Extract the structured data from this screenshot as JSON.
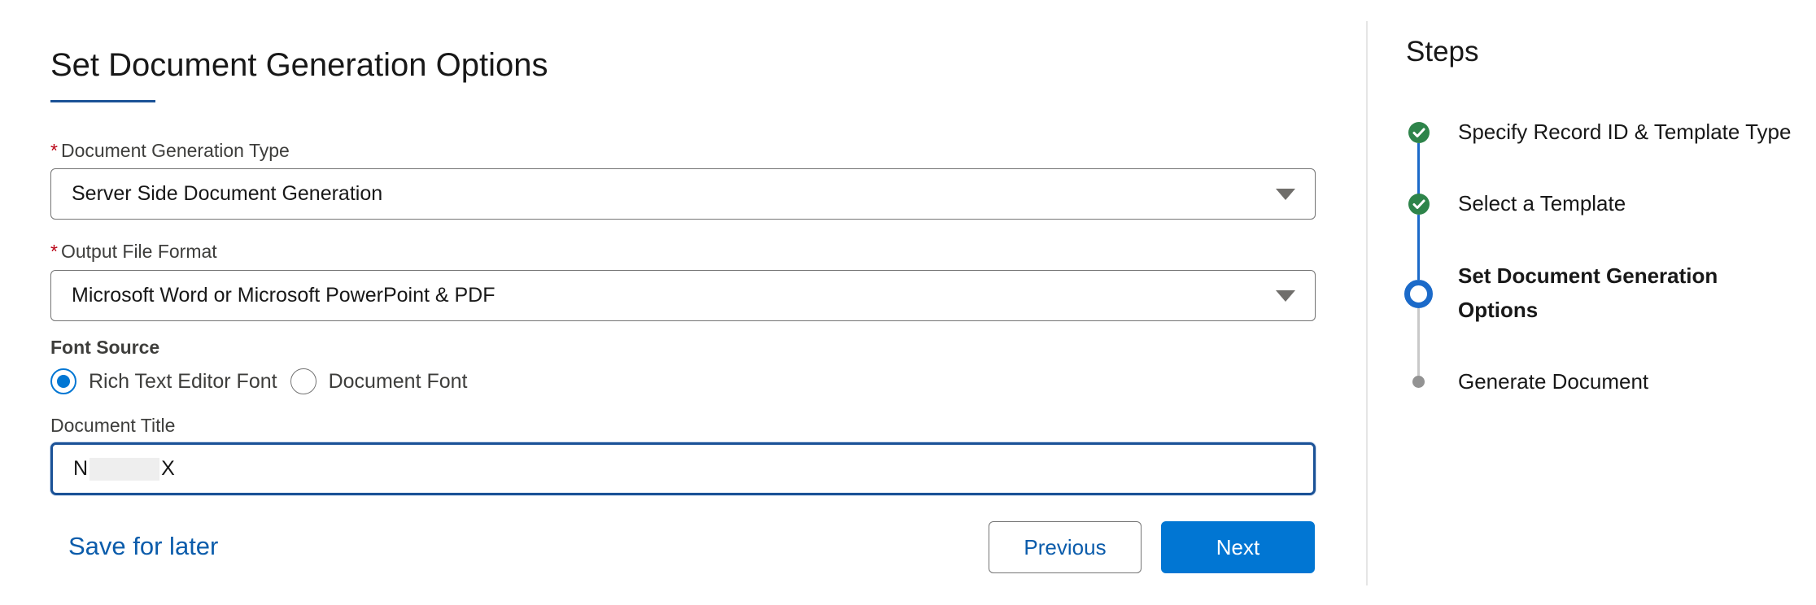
{
  "form": {
    "title": "Set Document Generation Options",
    "generation_type": {
      "label": "Document Generation Type",
      "required_marker": "*",
      "value": "Server Side Document Generation"
    },
    "output_format": {
      "label": "Output File Format",
      "required_marker": "*",
      "value": "Microsoft Word or Microsoft PowerPoint & PDF"
    },
    "font_source": {
      "label": "Font Source",
      "options": [
        {
          "label": "Rich Text Editor Font",
          "selected": true
        },
        {
          "label": "Document Font",
          "selected": false
        }
      ]
    },
    "document_title": {
      "label": "Document Title",
      "value_start": "N",
      "value_end": "X"
    },
    "save_for_later": "Save for later",
    "previous_label": "Previous",
    "next_label": "Next"
  },
  "steps": {
    "title": "Steps",
    "items": [
      {
        "label": "Specify Record ID & Template Type",
        "status": "complete"
      },
      {
        "label": "Select a Template",
        "status": "complete"
      },
      {
        "label": "Set Document Generation Options",
        "status": "current"
      },
      {
        "label": "Generate Document",
        "status": "upcoming"
      }
    ]
  },
  "colors": {
    "brand_blue": "#0176d3",
    "focus_border": "#1b5297",
    "complete_green": "#2e844a",
    "required_red": "#ba0517",
    "link_blue": "#0b5cab"
  }
}
